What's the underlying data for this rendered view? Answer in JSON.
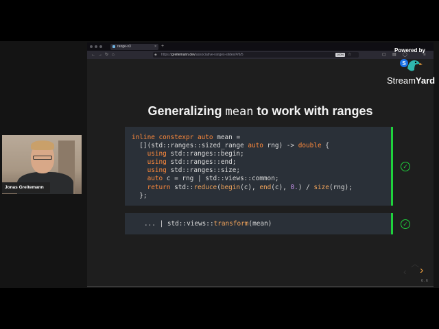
{
  "browser": {
    "tab_title": "range-v3",
    "tab_close": "×",
    "new_tab": "+",
    "url_prefix": "https://",
    "url_host": "greitemann.dev",
    "url_path": "/associative-ranges-slides/#/6/5",
    "zoom": "100%"
  },
  "slide": {
    "title_before": "Generalizing ",
    "title_code": "mean",
    "title_after": " to work with ranges",
    "slide_number": "6 . 6"
  },
  "code_block_1": [
    "inline constexpr auto mean =",
    "  [](std::ranges::sized_range auto rng) -> double {",
    "    using std::ranges::begin;",
    "    using std::ranges::end;",
    "    using std::ranges::size;",
    "    auto c = rng | std::views::common;",
    "    return std::reduce(begin(c), end(c), 0.) / size(rng);",
    "  };"
  ],
  "code_block_2": "... | std::views::transform(mean)",
  "checkmark": "✓",
  "webcam": {
    "name": "Jonas Greitemann"
  },
  "streamyard": {
    "powered_by": "Powered by",
    "brand_left": "Stream",
    "brand_right": "Yard"
  },
  "colors": {
    "accent_green": "#1fd13c",
    "keyword_orange": "#ff8a3c",
    "code_bg": "#2a3038"
  },
  "icons": [
    "back-icon",
    "forward-icon",
    "reload-icon",
    "home-icon",
    "shield-icon",
    "lock-icon",
    "bookmark-icon",
    "chevron-up-icon",
    "chevron-left-icon",
    "chevron-right-icon",
    "check-circle-icon",
    "streamyard-logo"
  ]
}
